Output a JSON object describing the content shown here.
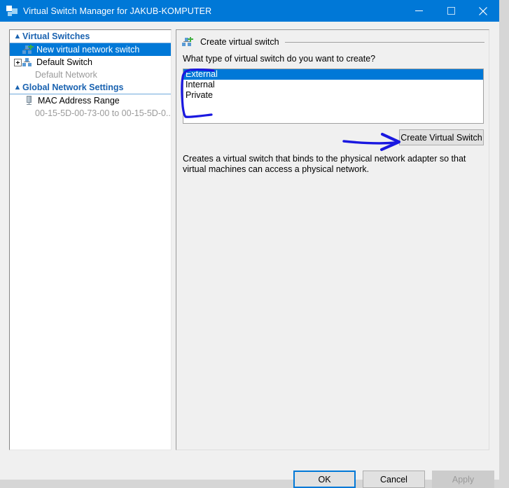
{
  "window": {
    "title": "Virtual Switch Manager for JAKUB-KOMPUTER",
    "icon": "virtual-switch-icon",
    "accent_color": "#0078d7",
    "controls": {
      "minimize": "minimize-icon",
      "maximize": "maximize-icon",
      "close": "close-icon"
    }
  },
  "sidebar": {
    "groups": [
      {
        "label": "Virtual Switches",
        "chevron": "collapse-chevron-icon",
        "items": [
          {
            "label": "New virtual network switch",
            "icon": "new-virtual-switch-icon",
            "selected": true,
            "expandable": false,
            "sublabel": ""
          },
          {
            "label": "Default Switch",
            "icon": "virtual-switch-icon",
            "selected": false,
            "expandable": true,
            "sublabel": "Default Network"
          }
        ]
      },
      {
        "label": "Global Network Settings",
        "chevron": "collapse-chevron-icon",
        "items": [
          {
            "label": "MAC Address Range",
            "icon": "mac-address-icon",
            "selected": false,
            "expandable": false,
            "sublabel": "00-15-5D-00-73-00 to 00-15-5D-0..."
          }
        ]
      }
    ]
  },
  "detail": {
    "section_title": "Create virtual switch",
    "section_icon": "new-virtual-switch-icon",
    "question": "What type of virtual switch do you want to create?",
    "switch_types": [
      {
        "label": "External",
        "selected": true
      },
      {
        "label": "Internal",
        "selected": false
      },
      {
        "label": "Private",
        "selected": false
      }
    ],
    "create_button_label": "Create Virtual Switch",
    "description": "Creates a virtual switch that binds to the physical network adapter so that virtual machines can access a physical network."
  },
  "footer": {
    "ok_label": "OK",
    "cancel_label": "Cancel",
    "apply_label": "Apply",
    "apply_enabled": false
  },
  "annotations": {
    "color": "#1a18e0",
    "bracket_target": "switch-type-listbox",
    "arrow_target": "create-virtual-switch-button"
  }
}
